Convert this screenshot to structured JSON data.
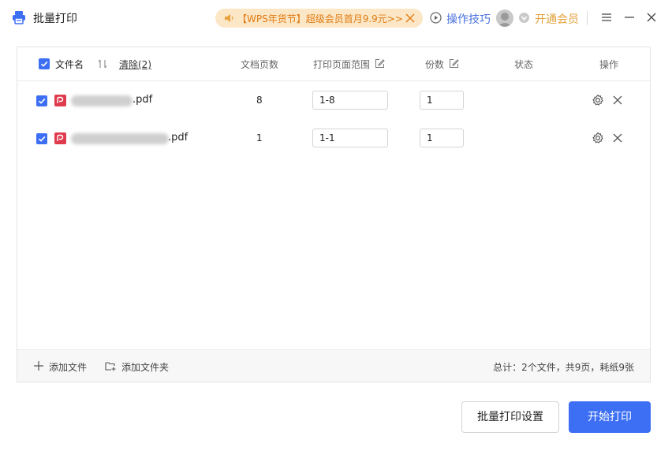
{
  "window": {
    "title": "批量打印",
    "promo_text": "【WPS年货节】超级会员首月9.9元>>",
    "tips_label": "操作技巧",
    "vip_label": "开通会员"
  },
  "table": {
    "headers": {
      "filename": "文件名",
      "clear": "清除(2)",
      "page_count": "文档页数",
      "print_range": "打印页面范围",
      "copies": "份数",
      "status": "状态",
      "actions": "操作"
    },
    "rows": [
      {
        "filename_suffix": ".pdf",
        "pages": "8",
        "range": "1-8",
        "copies": "1",
        "status": ""
      },
      {
        "filename_suffix": ".pdf",
        "pages": "1",
        "range": "1-1",
        "copies": "1",
        "status": ""
      }
    ]
  },
  "footer": {
    "add_file": "添加文件",
    "add_folder": "添加文件夹",
    "summary": "总计：2个文件，共9页，耗纸9张"
  },
  "buttons": {
    "settings": "批量打印设置",
    "start": "开始打印"
  },
  "colors": {
    "accent": "#3d6ff5",
    "promo_bg": "#fbe7c6",
    "promo_text": "#e07a12",
    "pdf_icon": "#e03a4d"
  }
}
